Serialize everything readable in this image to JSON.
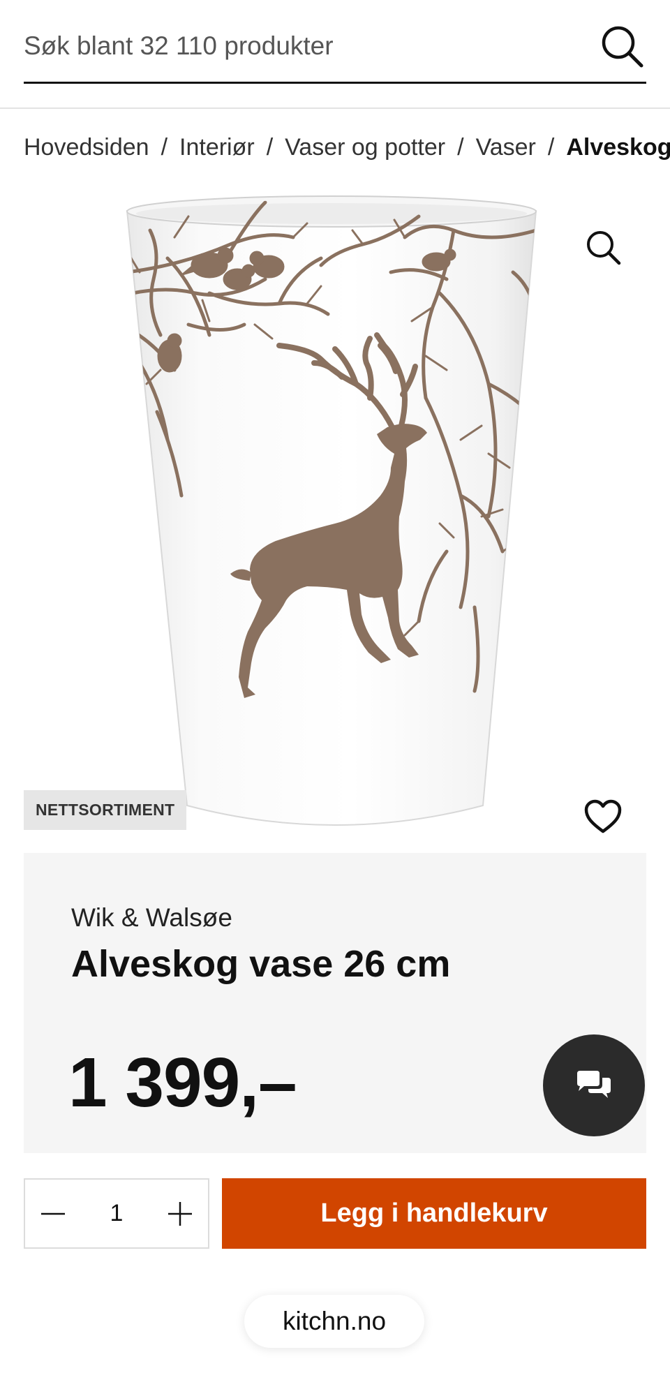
{
  "search": {
    "placeholder": "Søk blant 32 110 produkter"
  },
  "breadcrumb": {
    "items": [
      "Hovedsiden",
      "Interiør",
      "Vaser og potter",
      "Vaser"
    ],
    "current": "Alveskog",
    "separator": "/"
  },
  "product": {
    "badge": "NETTSORTIMENT",
    "brand": "Wik & Walsøe",
    "title": "Alveskog vase 26 cm",
    "price": "1 399,–",
    "image_colors": {
      "vase": "#ffffff",
      "motif": "#8a715f"
    }
  },
  "purchase": {
    "quantity": "1",
    "add_to_cart_label": "Legg i handlekurv",
    "cart_color": "#d14500"
  },
  "footer": {
    "site": "kitchn.no"
  }
}
